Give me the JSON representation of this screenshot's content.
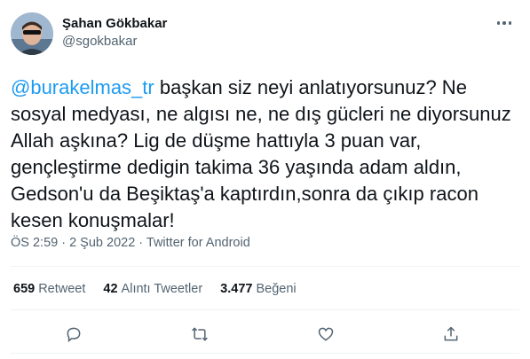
{
  "user": {
    "display_name": "Şahan Gökbakar",
    "handle": "@sgokbakar"
  },
  "tweet": {
    "mention": "@burakelmas_tr",
    "text": " başkan siz neyi anlatıyorsunuz? Ne sosyal medyası, ne algısı ne, ne dış gücleri ne diyorsunuz Allah aşkına? Lig de düşme hattıyla 3 puan var, gençleştirme dedigin takima 36 yaşında adam aldın, Gedson'u da Beşiktaş'a kaptırdın,sonra da çıkıp racon kesen konuşmalar!"
  },
  "meta": {
    "time": "ÖS 2:59",
    "separator1": " · ",
    "date": "2 Şub 2022",
    "separator2": " · ",
    "source": "Twitter for Android"
  },
  "stats": {
    "retweets_count": "659",
    "retweets_label": "Retweet",
    "quotes_count": "42",
    "quotes_label": "Alıntı Tweetler",
    "likes_count": "3.477",
    "likes_label": "Beğeni"
  },
  "colors": {
    "accent": "#1d9bf0",
    "secondary_text": "#536471",
    "divider": "#eff3f4"
  },
  "icons": {
    "more": "more-icon",
    "reply": "reply-icon",
    "retweet": "retweet-icon",
    "like": "like-icon",
    "share": "share-icon"
  }
}
